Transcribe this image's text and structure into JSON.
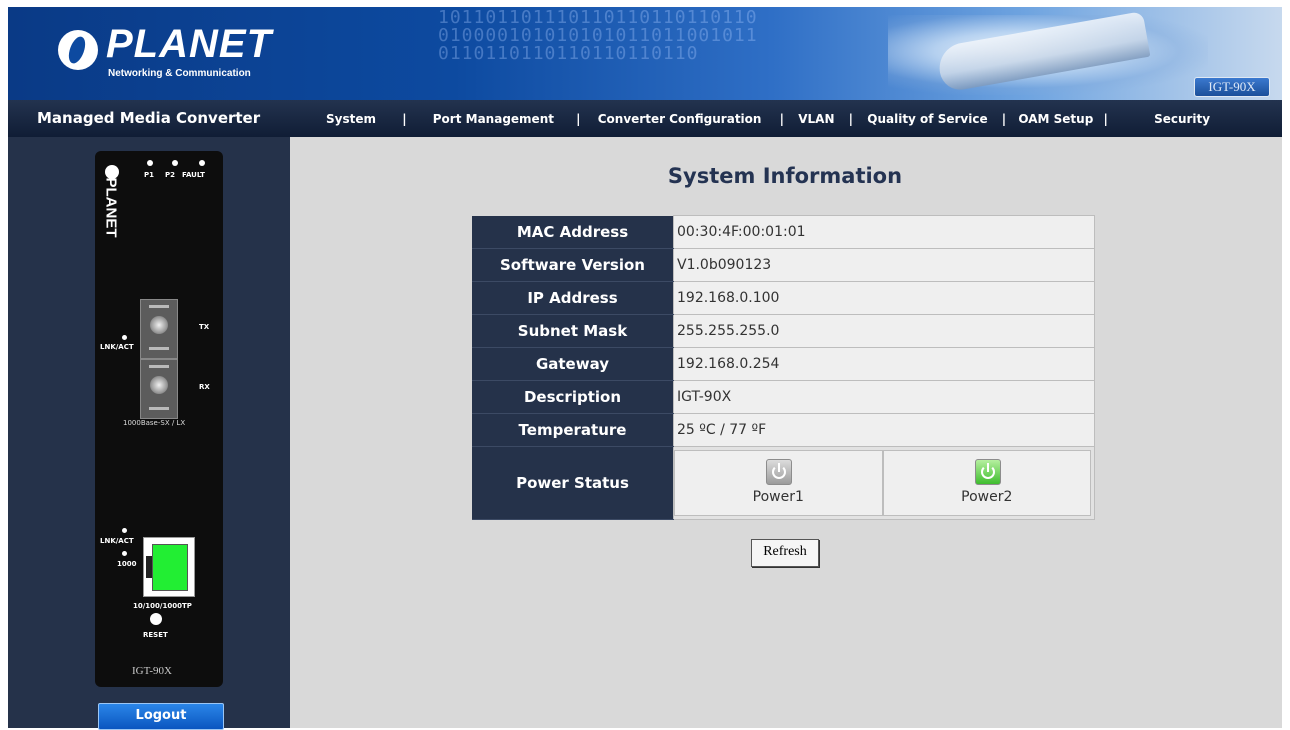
{
  "header": {
    "logo_name": "PLANET",
    "logo_subtitle": "Networking & Communication",
    "model_badge": "IGT-90X"
  },
  "nav": {
    "title": "Managed Media Converter",
    "items": [
      "System",
      "Port Management",
      "Converter Configuration",
      "VLAN",
      "Quality of Service",
      "OAM Setup",
      "Security"
    ],
    "separator": "|"
  },
  "device": {
    "brand": "PLANET",
    "led_labels": [
      "P1",
      "P2",
      "FAULT"
    ],
    "tx_label": "TX",
    "rx_label": "RX",
    "lnk_act_label": "LNK/ACT",
    "fiber_type": "1000Base-SX / LX",
    "speed_label": "1000",
    "copper_type": "10/100/1000TP",
    "reset_label": "RESET",
    "model": "IGT-90X"
  },
  "logout_label": "Logout",
  "main": {
    "title": "System Information",
    "rows": [
      {
        "key": "MAC Address",
        "value": "00:30:4F:00:01:01"
      },
      {
        "key": "Software Version",
        "value": "V1.0b090123"
      },
      {
        "key": "IP Address",
        "value": "192.168.0.100"
      },
      {
        "key": "Subnet Mask",
        "value": "255.255.255.0"
      },
      {
        "key": "Gateway",
        "value": "192.168.0.254"
      },
      {
        "key": "Description",
        "value": "IGT-90X"
      },
      {
        "key": "Temperature",
        "value": "25 ºC / 77 ºF"
      }
    ],
    "power_status": {
      "key": "Power Status",
      "power1_label": "Power1",
      "power1_state": "off",
      "power2_label": "Power2",
      "power2_state": "on"
    },
    "refresh_label": "Refresh"
  },
  "colors": {
    "navbar_bg": "#1a2740",
    "key_cell_bg": "#25324a",
    "main_bg": "#d9d9d9",
    "power_on": "#3fbd2e",
    "power_off": "#9b9b9b"
  }
}
